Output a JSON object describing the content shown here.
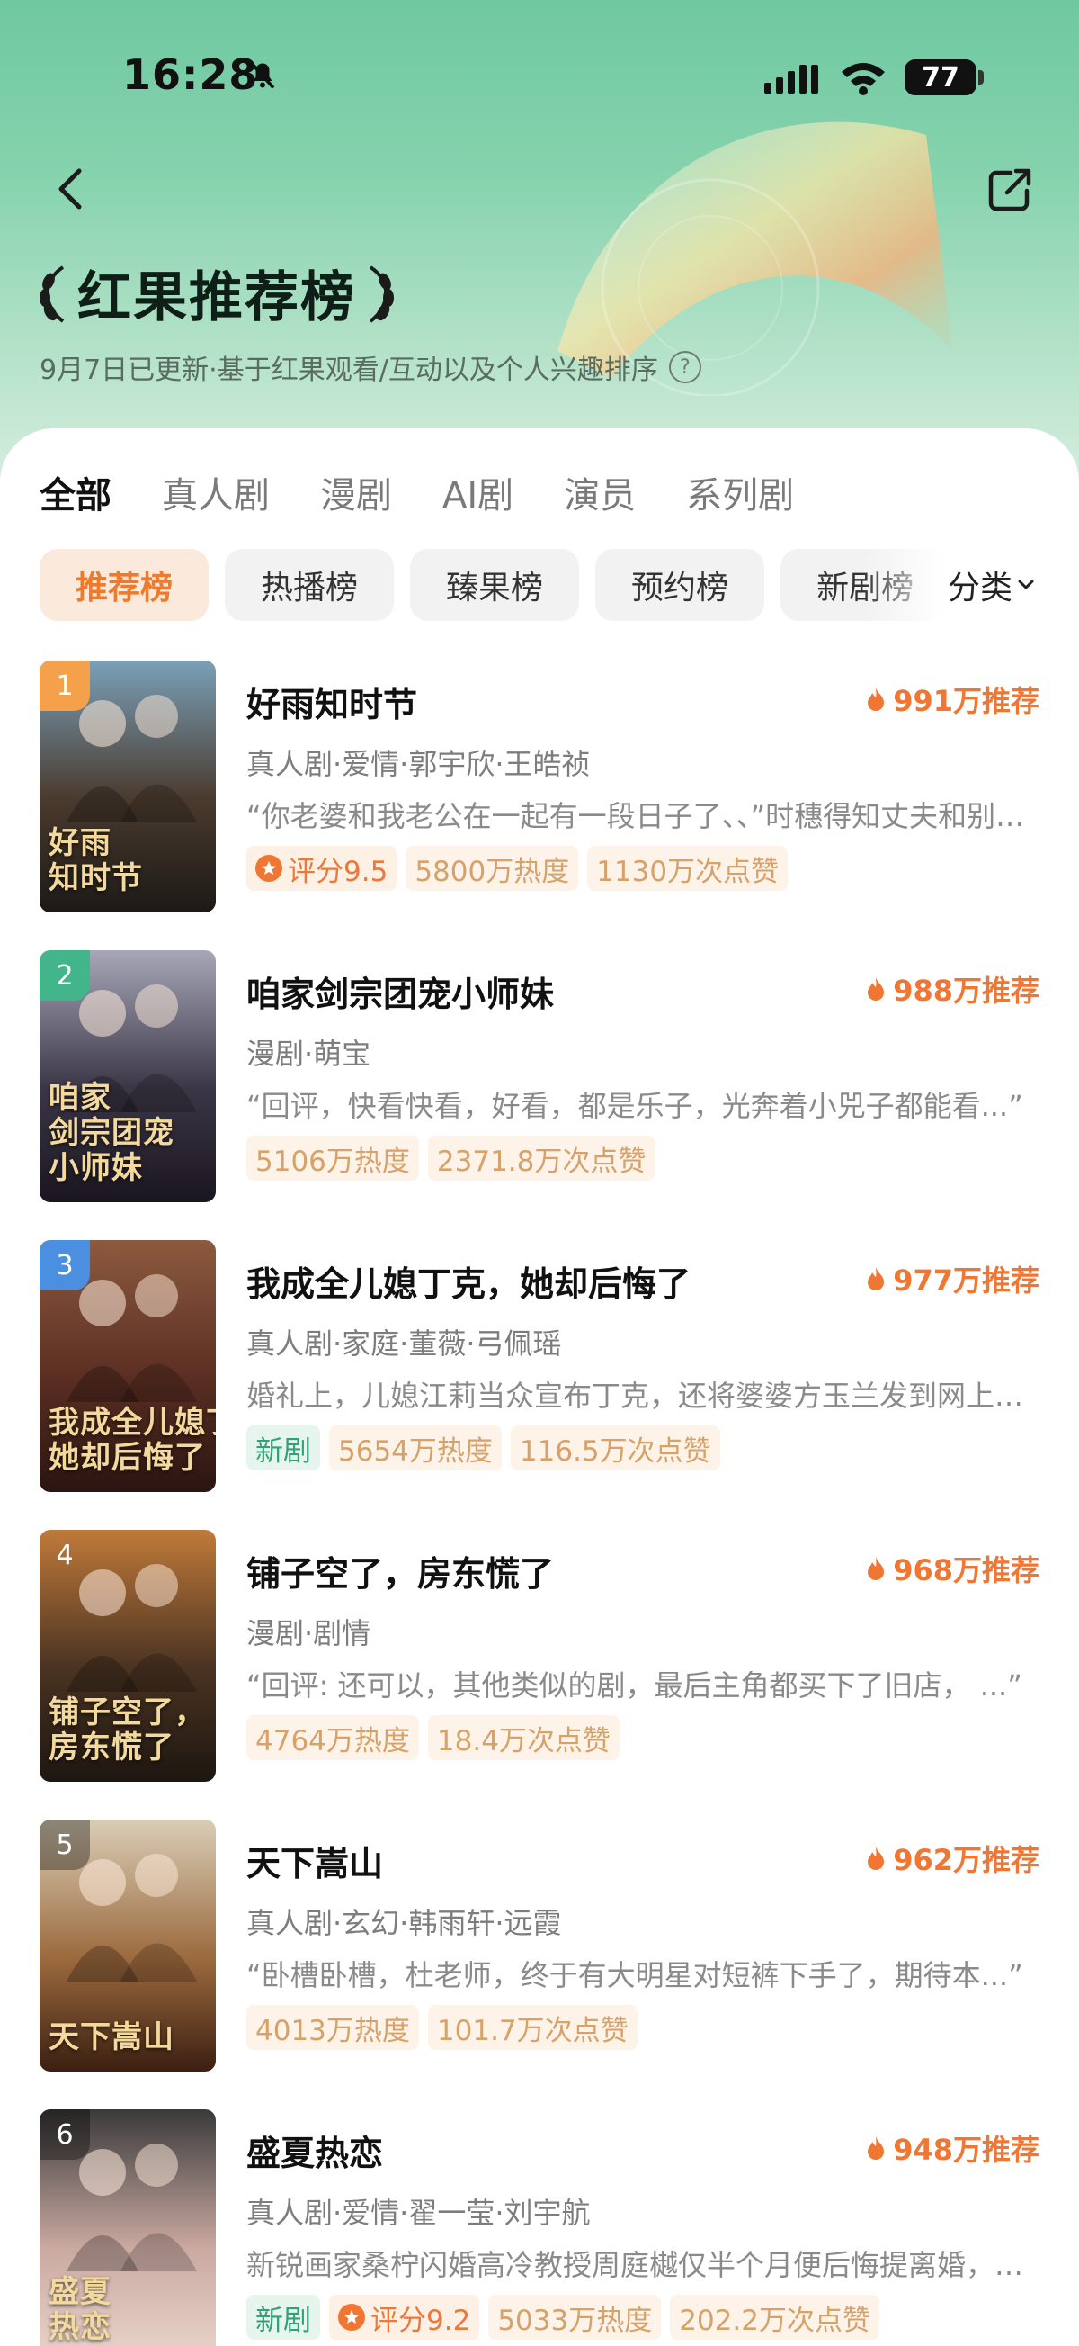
{
  "status_bar": {
    "time": "16:28",
    "battery": "77"
  },
  "header": {
    "title": "红果推荐榜",
    "subtitle": "9月7日已更新·基于红果观看/互动以及个人兴趣排序",
    "help_glyph": "?"
  },
  "tabs": [
    "全部",
    "真人剧",
    "漫剧",
    "AI剧",
    "演员",
    "系列剧"
  ],
  "chips": [
    "推荐榜",
    "热播榜",
    "臻果榜",
    "预约榜",
    "新剧榜"
  ],
  "sort_label": "分类",
  "items": [
    {
      "rank": "1",
      "rank_color": "#f5a04b",
      "poster_colors": [
        "#7aa0b8",
        "#4a3a2e",
        "#1c1a16"
      ],
      "poster_text": "好雨\n知时节",
      "title": "好雨知时节",
      "score": "991万推荐",
      "meta": "真人剧·爱情·郭宇欣·王皓祯",
      "desc": "“你老婆和我老公在一起有一段日子了、、”时穗得知丈夫和别人的老婆有染，两人决定联手报复",
      "tags": [
        {
          "type": "rating",
          "text": "评分9.5"
        },
        {
          "type": "heat",
          "text": "5800万热度"
        },
        {
          "type": "heat",
          "text": "1130万次点赞"
        }
      ]
    },
    {
      "rank": "2",
      "rank_color": "#43b58a",
      "poster_colors": [
        "#a7a7b8",
        "#3b3646",
        "#1a1620"
      ],
      "poster_text": "咱家\n剑宗团宠\n小师妹",
      "title": "咱家剑宗团宠小师妹",
      "score": "988万推荐",
      "meta": "漫剧·萌宝",
      "desc": "“回评，快看快看，好看，都是乐子，光奔着小兕子都能看...”",
      "tags": [
        {
          "type": "heat",
          "text": "5106万热度"
        },
        {
          "type": "heat",
          "text": "2371.8万次点赞"
        }
      ]
    },
    {
      "rank": "3",
      "rank_color": "#4b8fe0",
      "poster_colors": [
        "#8c5a3e",
        "#5a2e22",
        "#2a1510"
      ],
      "poster_text": "我成全儿媳丁克，\n她却后悔了",
      "title": "我成全儿媳丁克，她却后悔了",
      "score": "977万推荐",
      "meta": "真人剧·家庭·董薇·弓佩瑶",
      "desc": "婚礼上，儿媳江莉当众宣布丁克，还将婆婆方玉兰发到网上，方玉兰决定成全她",
      "tags": [
        {
          "type": "new",
          "text": "新剧"
        },
        {
          "type": "heat",
          "text": "5654万热度"
        },
        {
          "type": "heat",
          "text": "116.5万次点赞"
        }
      ]
    },
    {
      "rank": "4",
      "rank_color": "rgba(0,0,0,0)",
      "poster_colors": [
        "#c07a3a",
        "#4a3322",
        "#1d1610"
      ],
      "poster_text": "铺子空了，\n房东慌了",
      "title": "铺子空了，房东慌了",
      "score": "968万推荐",
      "meta": "漫剧·剧情",
      "desc": "“回评: 还可以，其他类似的剧，最后主角都买下了旧店，   ...”",
      "tags": [
        {
          "type": "heat",
          "text": "4764万热度"
        },
        {
          "type": "heat",
          "text": "18.4万次点赞"
        }
      ]
    },
    {
      "rank": "5",
      "rank_color": "rgba(0,0,0,0.35)",
      "poster_colors": [
        "#d9cdb6",
        "#9c6a3e",
        "#3b1f12"
      ],
      "poster_text": "天下嵩山",
      "title": "天下嵩山",
      "score": "962万推荐",
      "meta": "真人剧·玄幻·韩雨轩·远霞",
      "desc": "“卧槽卧槽，杜老师，终于有大明星对短裤下手了，期待本...”",
      "tags": [
        {
          "type": "heat",
          "text": "4013万热度"
        },
        {
          "type": "heat",
          "text": "101.7万次点赞"
        }
      ]
    },
    {
      "rank": "6",
      "rank_color": "rgba(0,0,0,0.35)",
      "poster_colors": [
        "#3a3a3a",
        "#caa9a1",
        "#e9d6cc"
      ],
      "poster_text": "盛夏\n热恋",
      "title": "盛夏热恋",
      "score": "948万推荐",
      "meta": "真人剧·爱情·翟一莹·刘宇航",
      "desc": "新锐画家桑柠闪婚高冷教授周庭樾仅半个月便后悔提离婚，却发现他暗恋自己多年",
      "tags": [
        {
          "type": "new",
          "text": "新剧"
        },
        {
          "type": "rating",
          "text": "评分9.2"
        },
        {
          "type": "heat",
          "text": "5033万热度"
        },
        {
          "type": "heat",
          "text": "202.2万次点赞"
        }
      ]
    }
  ]
}
